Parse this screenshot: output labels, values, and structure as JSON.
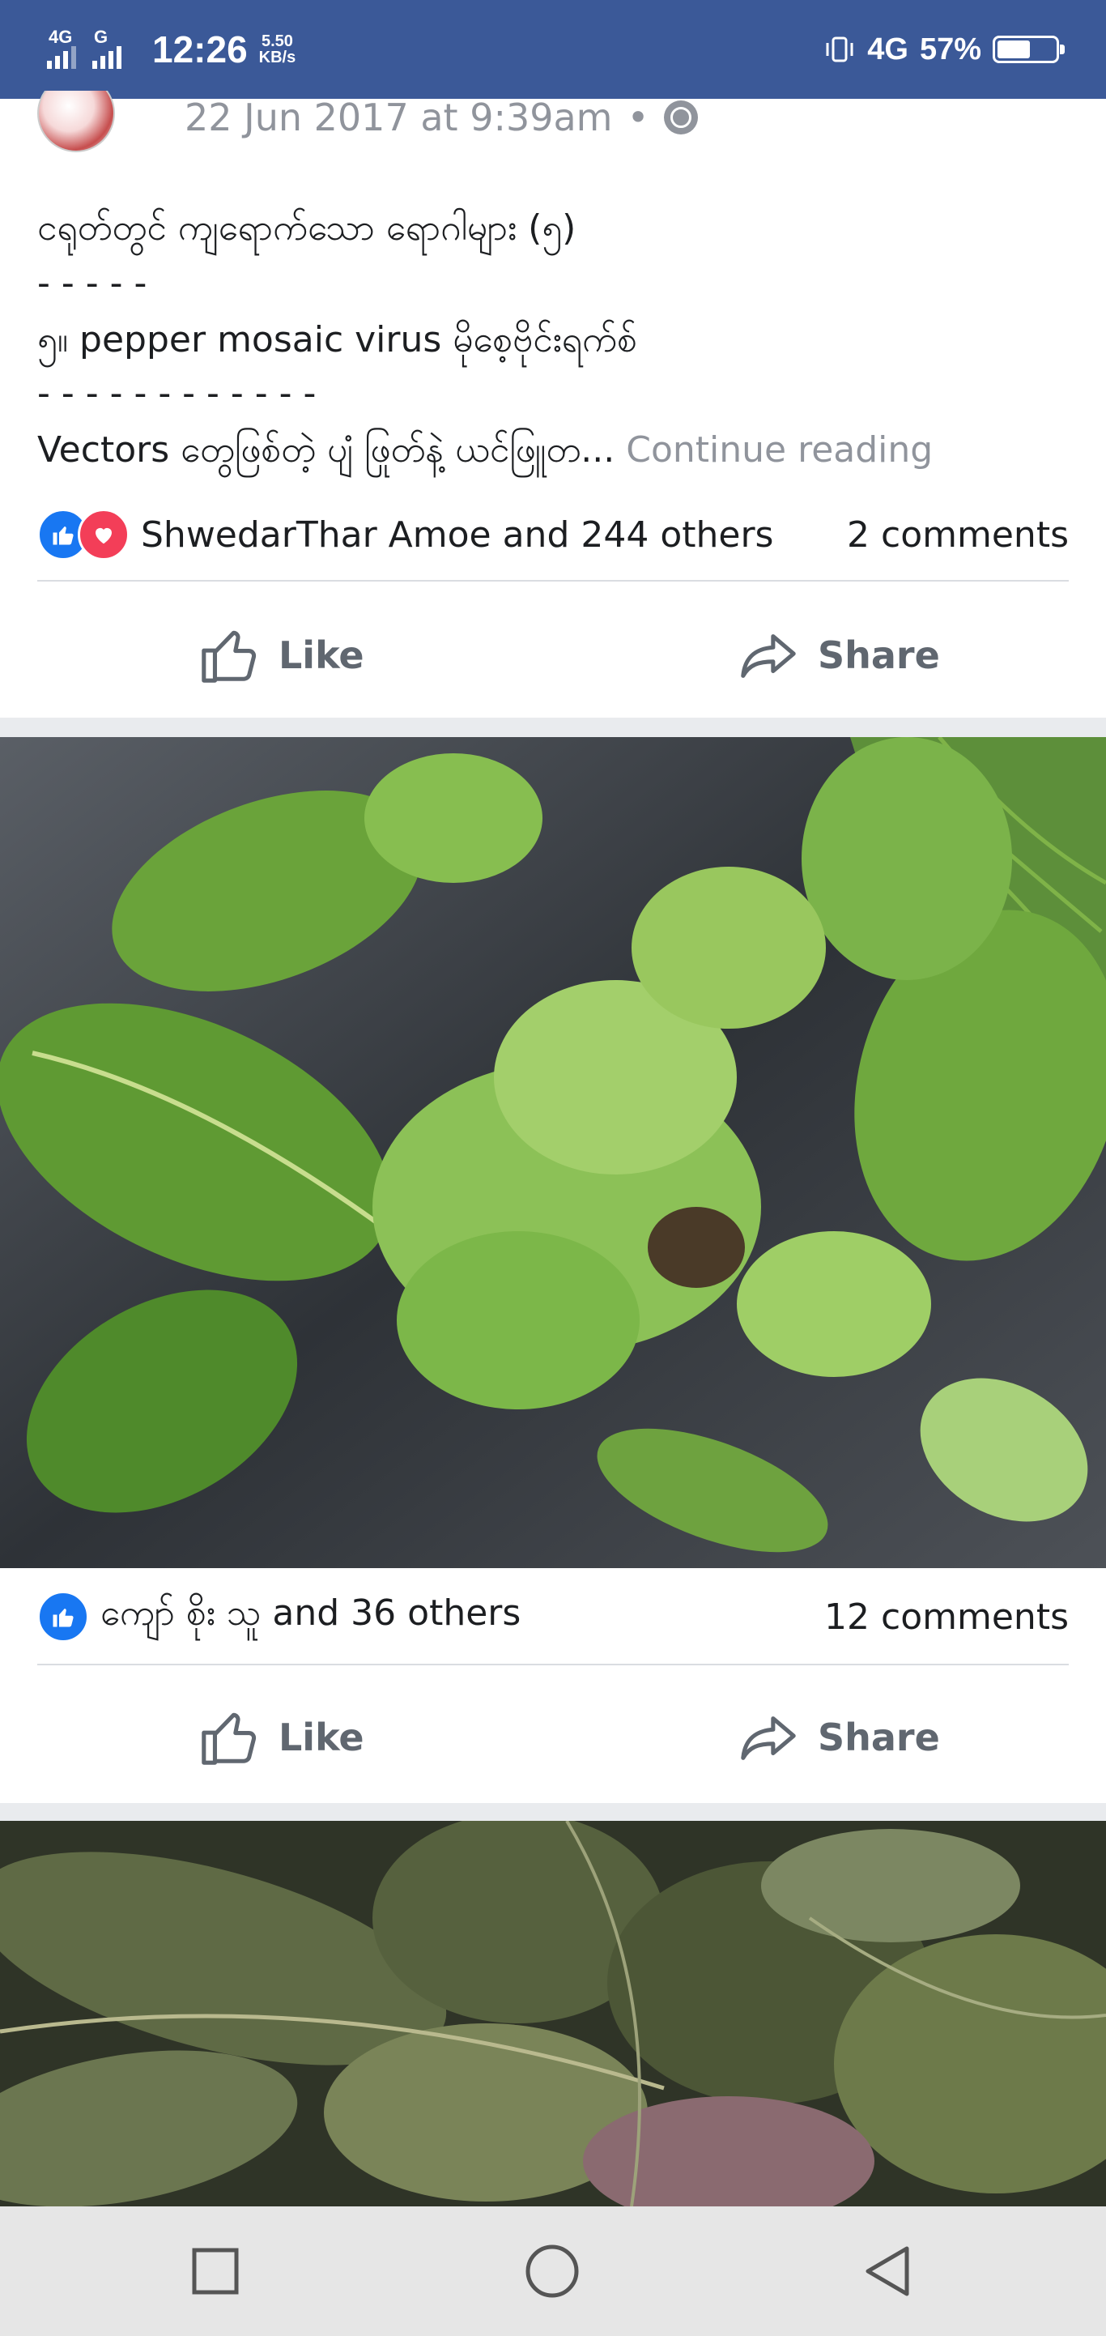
{
  "status_bar": {
    "net1_label": "4G",
    "net2_label": "G",
    "time": "12:26",
    "speed_value": "5.50",
    "speed_unit": "KB/s",
    "network_type": "4G",
    "battery_percent": "57%",
    "battery_level": 0.57
  },
  "post1": {
    "timestamp": "22 Jun 2017 at 9:39am",
    "separator": "•",
    "line1": "ငရုတ်တွင် ကျရောက်သော ရောဂါများ (၅)",
    "line2": "- - - - -",
    "line3": "၅။ pepper mosaic virus မိုစေ့ဗိုင်းရက်စ်",
    "line4": "- - - - - - - - - - - -",
    "line5": "Vectors တွေဖြစ်တဲ့ ပျံ ဖြုတ်နဲ့ ယင်ဖြူတ...",
    "continue_label": "Continue reading",
    "reactions_text": "ShwedarThar Amoe and 244 others",
    "comments": "2 comments",
    "like_label": "Like",
    "share_label": "Share"
  },
  "post2": {
    "reactions_text": "ကျော် စိုး သူ and 36 others",
    "comments": "12 comments",
    "like_label": "Like",
    "share_label": "Share"
  },
  "colors": {
    "status_bar": "#3b5998",
    "like_blue": "#1877f2",
    "love_red": "#f33e58",
    "muted_text": "#90949c"
  },
  "icons": [
    "like-icon",
    "love-icon",
    "thumbs-up-icon",
    "share-arrow-icon",
    "globe-icon",
    "square-nav-icon",
    "circle-nav-icon",
    "triangle-back-icon"
  ]
}
